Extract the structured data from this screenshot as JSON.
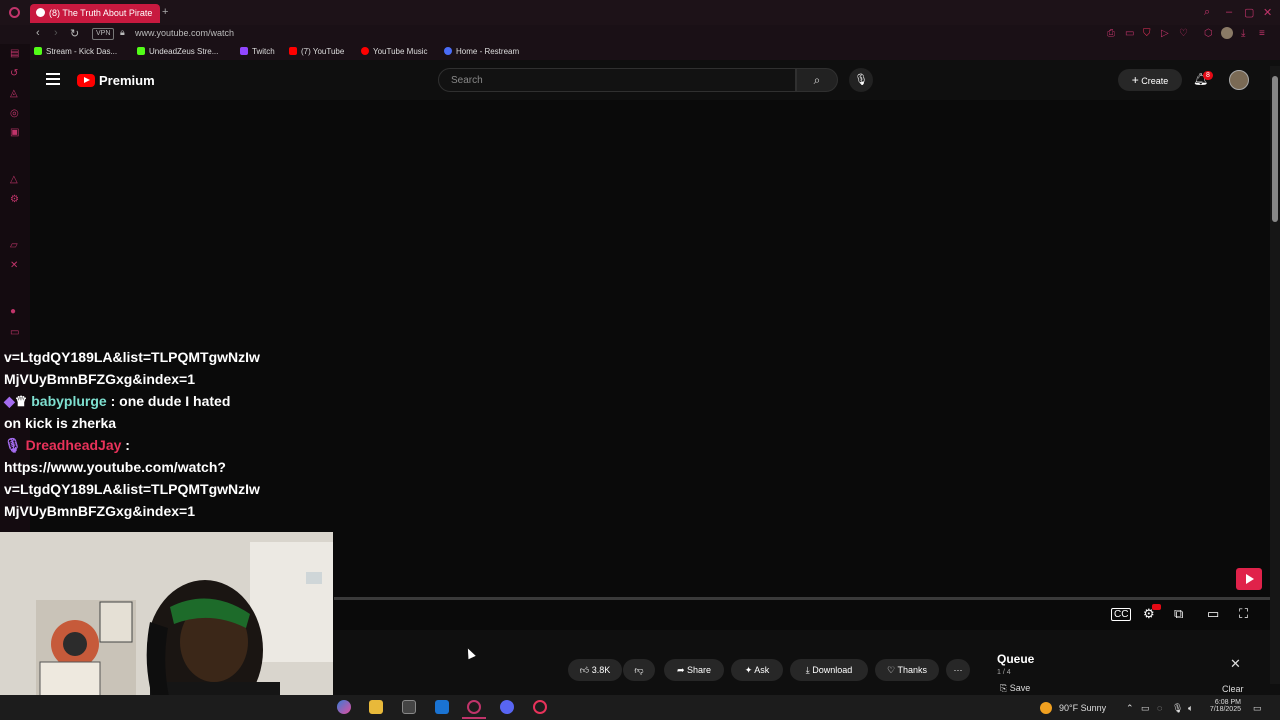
{
  "browser": {
    "tab_title": "(8) The Truth About Pirate",
    "address": "www.youtube.com/watch",
    "vpn_label": "VPN",
    "accent": "#c0346a"
  },
  "bookmarks": [
    {
      "label": "Stream - Kick Das...",
      "color": "#53fc18"
    },
    {
      "label": "UndeadZeus Stre...",
      "color": "#53fc18"
    },
    {
      "label": "Twitch",
      "color": "#9146ff"
    },
    {
      "label": "(7) YouTube",
      "color": "#ff0000"
    },
    {
      "label": "YouTube Music",
      "color": "#ff0000"
    },
    {
      "label": "Home - Restream",
      "color": "#4a6cf7"
    }
  ],
  "yt": {
    "brand": "Premium",
    "search_placeholder": "Search",
    "create_label": "Create",
    "notif_count": "8"
  },
  "chat": {
    "line1": "v=LtgdQY189LA&list=TLPQMTgwNzIw",
    "line2": "MjVUyBmnBFZGxg&index=1",
    "msg1_user": "babyplurge",
    "msg1_sep": " : ",
    "msg1_text": "one dude I hated",
    "msg1_text2": "on kick is zherka",
    "msg2_user": "DreadheadJay",
    "msg2_sep": " :",
    "msg2_l1": "https://www.youtube.com/watch?",
    "msg2_l2": "v=LtgdQY189LA&list=TLPQMTgwNzIw",
    "msg2_l3": "MjVUyBmnBFZGxg&index=1"
  },
  "actions": {
    "likes": "3.8K",
    "share": "Share",
    "ask": "Ask",
    "download": "Download",
    "thanks": "Thanks"
  },
  "queue": {
    "title": "Queue",
    "position": "1 / 4",
    "save": "Save",
    "clear": "Clear"
  },
  "taskbar": {
    "weather": "90°F  Sunny",
    "time": "6:08 PM",
    "date": "7/18/2025"
  }
}
